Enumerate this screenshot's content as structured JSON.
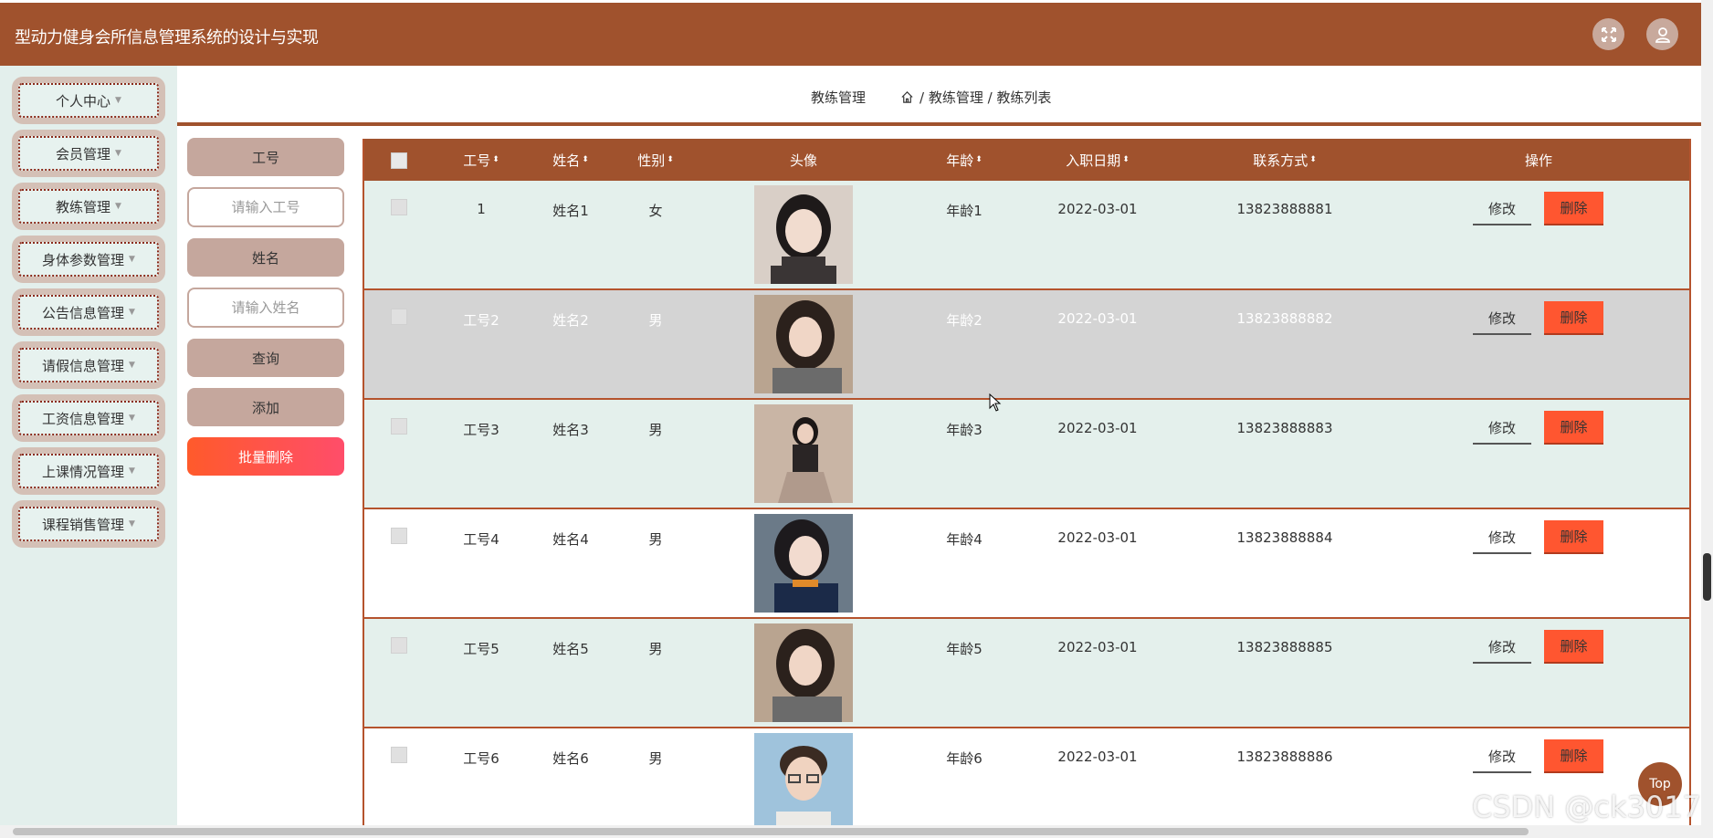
{
  "header": {
    "title": "型动力健身会所信息管理系统的设计与实现",
    "fullscreen_icon": "fullscreen-icon",
    "user_icon": "user-icon"
  },
  "sidebar": {
    "items": [
      {
        "label": "个人中心"
      },
      {
        "label": "会员管理"
      },
      {
        "label": "教练管理"
      },
      {
        "label": "身体参数管理"
      },
      {
        "label": "公告信息管理"
      },
      {
        "label": "请假信息管理"
      },
      {
        "label": "工资信息管理"
      },
      {
        "label": "上课情况管理"
      },
      {
        "label": "课程销售管理"
      }
    ]
  },
  "breadcrumb": {
    "title": "教练管理",
    "home_icon": "home-icon",
    "path": "/ 教练管理 / 教练列表"
  },
  "search": {
    "id_label": "工号",
    "id_placeholder": "请输入工号",
    "name_label": "姓名",
    "name_placeholder": "请输入姓名",
    "query_button": "查询",
    "add_button": "添加",
    "batch_delete_button": "批量删除"
  },
  "table": {
    "columns": [
      "工号",
      "姓名",
      "性别",
      "头像",
      "年龄",
      "入职日期",
      "联系方式",
      "操作"
    ],
    "edit_label": "修改",
    "delete_label": "删除",
    "rows": [
      {
        "id": "1",
        "name": "姓名1",
        "gender": "女",
        "age": "年龄1",
        "date": "2022-03-01",
        "phone": "13823888881"
      },
      {
        "id": "工号2",
        "name": "姓名2",
        "gender": "男",
        "age": "年龄2",
        "date": "2022-03-01",
        "phone": "13823888882"
      },
      {
        "id": "工号3",
        "name": "姓名3",
        "gender": "男",
        "age": "年龄3",
        "date": "2022-03-01",
        "phone": "13823888883"
      },
      {
        "id": "工号4",
        "name": "姓名4",
        "gender": "男",
        "age": "年龄4",
        "date": "2022-03-01",
        "phone": "13823888884"
      },
      {
        "id": "工号5",
        "name": "姓名5",
        "gender": "男",
        "age": "年龄5",
        "date": "2022-03-01",
        "phone": "13823888885"
      },
      {
        "id": "工号6",
        "name": "姓名6",
        "gender": "男",
        "age": "年龄6",
        "date": "2022-03-01",
        "phone": "13823888886"
      }
    ]
  },
  "top_button": "Top",
  "watermark": "CSDN @ck3017",
  "colors": {
    "accent": "#a0522d",
    "danger": "#ff5630",
    "sidebar_bg": "#e3efec",
    "row_alt": "#e4f0ec",
    "row_hover": "#d4d4d4"
  }
}
